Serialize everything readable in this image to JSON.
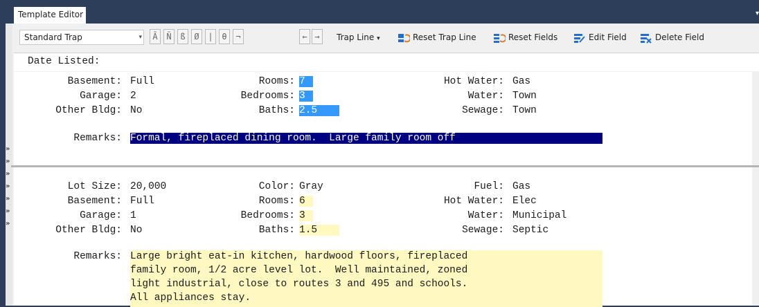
{
  "tab": {
    "title": "Template Editor"
  },
  "toolbar": {
    "combo_value": "Standard Trap",
    "char_buttons": [
      "Ã",
      "Ñ",
      "ß",
      "Ø",
      "|",
      "θ",
      "¬"
    ],
    "arrow_left": "←",
    "arrow_right": "→",
    "trap_line_label": "Trap Line",
    "reset_trap_line_label": "Reset Trap Line",
    "reset_fields_label": "Reset Fields",
    "edit_field_label": "Edit Field",
    "delete_field_label": "Delete Field"
  },
  "date_line": "Date Listed:",
  "record1": {
    "basement_label": "Basement:",
    "basement": "Full",
    "garage_label": "Garage:",
    "garage": "2",
    "other_label": "Other Bldg:",
    "other": "No",
    "rooms_label": "Rooms:",
    "rooms": "7",
    "bedrooms_label": "Bedrooms:",
    "bedrooms": "3",
    "baths_label": "Baths:",
    "baths": "2.5",
    "hotwater_label": "Hot Water:",
    "hotwater": "Gas",
    "water_label": "Water:",
    "water": "Town",
    "sewage_label": "Sewage:",
    "sewage": "Town",
    "remarks_label": "Remarks:",
    "remarks": "Formal, fireplaced dining room.  Large family room off"
  },
  "record2": {
    "lotsize_label": "Lot Size:",
    "lotsize": "20,000",
    "basement_label": "Basement:",
    "basement": "Full",
    "garage_label": "Garage:",
    "garage": "1",
    "other_label": "Other Bldg:",
    "other": "No",
    "color_label": "Color:",
    "color": "Gray",
    "rooms_label": "Rooms:",
    "rooms": "6",
    "bedrooms_label": "Bedrooms:",
    "bedrooms": "3",
    "baths_label": "Baths:",
    "baths": "1.5",
    "fuel_label": "Fuel:",
    "fuel": "Gas",
    "hotwater_label": "Hot Water:",
    "hotwater": "Elec",
    "water_label": "Water:",
    "water": "Municipal",
    "sewage_label": "Sewage:",
    "sewage": "Septic",
    "remarks_label": "Remarks:",
    "remarks_lines": [
      "Large bright eat-in kitchen, hardwood floors, fireplaced",
      "family room, 1/2 acre level lot.  Well maintained, zoned",
      "light industrial, close to routes 3 and 495 and schools.",
      "All appliances stay."
    ]
  },
  "gutter_marker": "»"
}
